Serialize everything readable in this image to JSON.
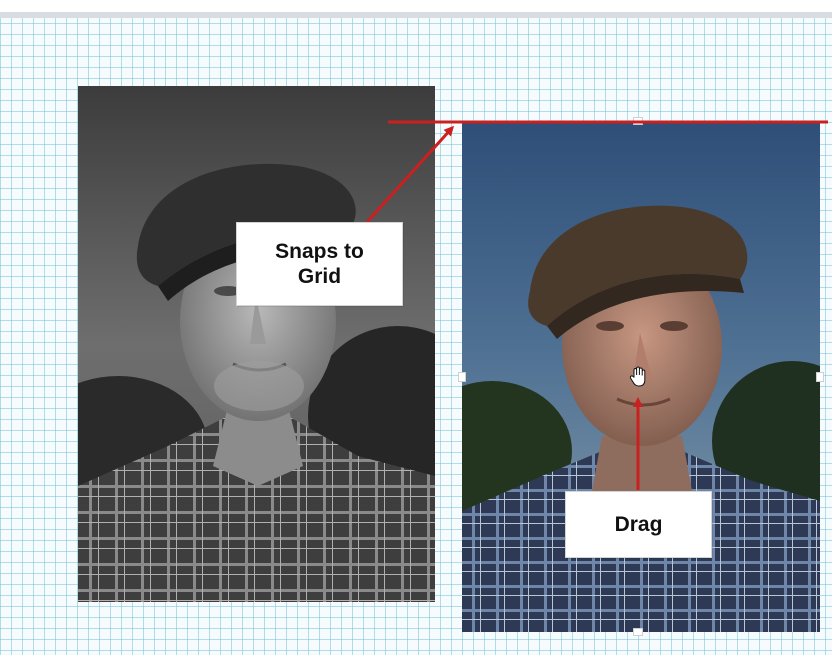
{
  "annotations": {
    "snap_label_line1": "Snaps to",
    "snap_label_line2": "Grid",
    "drag_label": "Drag"
  },
  "images": [
    {
      "name": "bw-portrait",
      "description_icon": "photo-icon",
      "style": "black-and-white"
    },
    {
      "name": "color-portrait",
      "description_icon": "photo-icon",
      "style": "color"
    }
  ],
  "cursor": {
    "icon": "hand-cursor-icon"
  },
  "colors": {
    "grid_line": "#78c4d6",
    "grid_background": "#f6fbfd",
    "arrow": "#cc1f1f",
    "snap_line": "#cc1f1f",
    "callout_background": "#ffffff"
  }
}
